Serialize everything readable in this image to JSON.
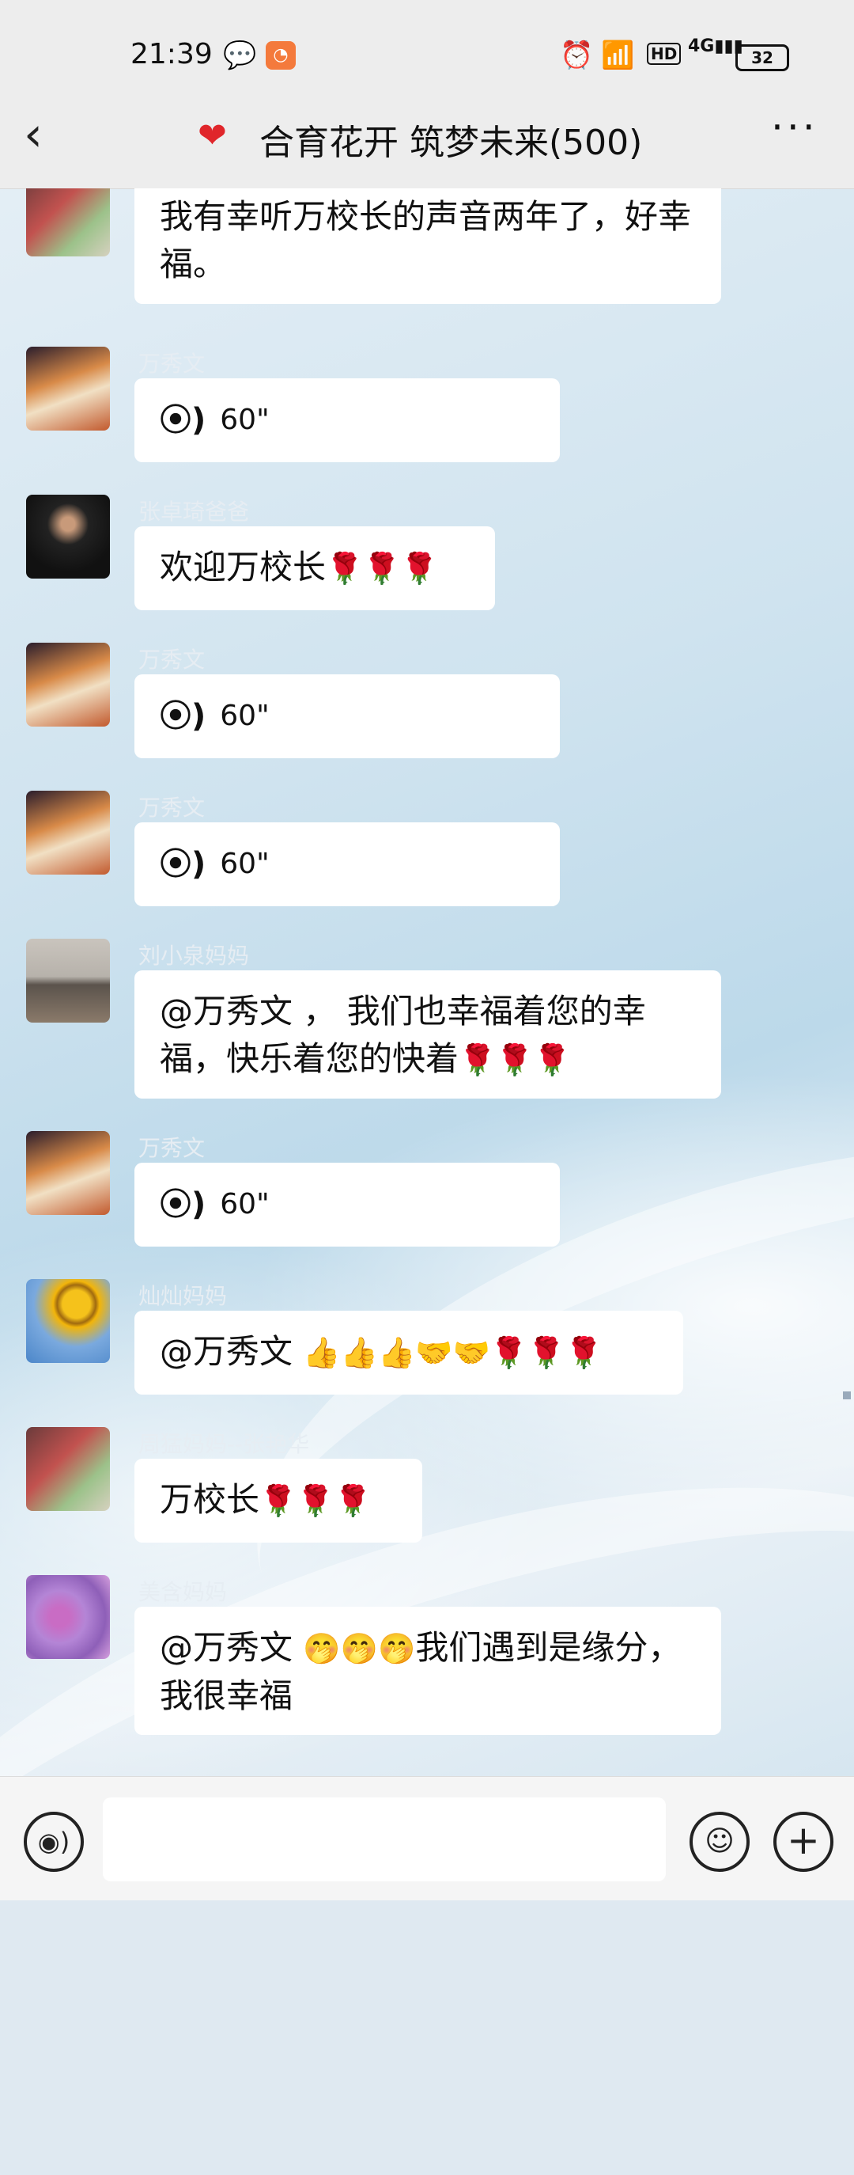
{
  "status_bar": {
    "time": "21:39",
    "network": "4G",
    "hd": "HD",
    "battery": "32"
  },
  "header": {
    "title": "合育花开 筑梦未来(500)",
    "title_icon": "red-heart-icon"
  },
  "messages": [
    {
      "sender": "",
      "type": "text",
      "text": "我有幸听万校长的声音两年了，好幸福。",
      "avatar": "peony-flowers"
    },
    {
      "sender": "万秀文",
      "type": "voice",
      "duration": "60\"",
      "avatar": "woman-portrait"
    },
    {
      "sender": "张卓琦爸爸",
      "type": "text",
      "text": "欢迎万校长",
      "emoji": "🌹🌹🌹",
      "avatar": "man-in-suit"
    },
    {
      "sender": "万秀文",
      "type": "voice",
      "duration": "60\"",
      "avatar": "woman-portrait"
    },
    {
      "sender": "万秀文",
      "type": "voice",
      "duration": "60\"",
      "avatar": "woman-portrait"
    },
    {
      "sender": "刘小泉妈妈",
      "type": "text",
      "text": "@万秀文 ， 我们也幸福着您的幸福，快乐着您的快着",
      "emoji": "🌹🌹🌹",
      "avatar": "lake-skyline"
    },
    {
      "sender": "万秀文",
      "type": "voice",
      "duration": "60\"",
      "avatar": "woman-portrait"
    },
    {
      "sender": "灿灿妈妈",
      "type": "text",
      "text": "@万秀文 ",
      "emoji": "👍👍👍🤝🤝🌹🌹🌹",
      "avatar": "sunflowers"
    },
    {
      "sender": "周猛妈妈--张艳华",
      "type": "text",
      "text": "万校长",
      "emoji": "🌹🌹🌹",
      "avatar": "peony-flowers"
    },
    {
      "sender": "美含妈妈",
      "type": "text",
      "text": "@万秀文 ",
      "emoji": "🤭🤭🤭",
      "text2": "我们遇到是缘分，我很幸福",
      "avatar": "pink-flowers"
    }
  ],
  "input_bar": {
    "voice_icon": "voice-icon",
    "emoji_icon": "emoji-icon",
    "plus_icon": "plus-icon"
  },
  "colors": {
    "bubble": "#ffffff",
    "bar": "#ededed",
    "sender_name": "#e6edf3"
  }
}
